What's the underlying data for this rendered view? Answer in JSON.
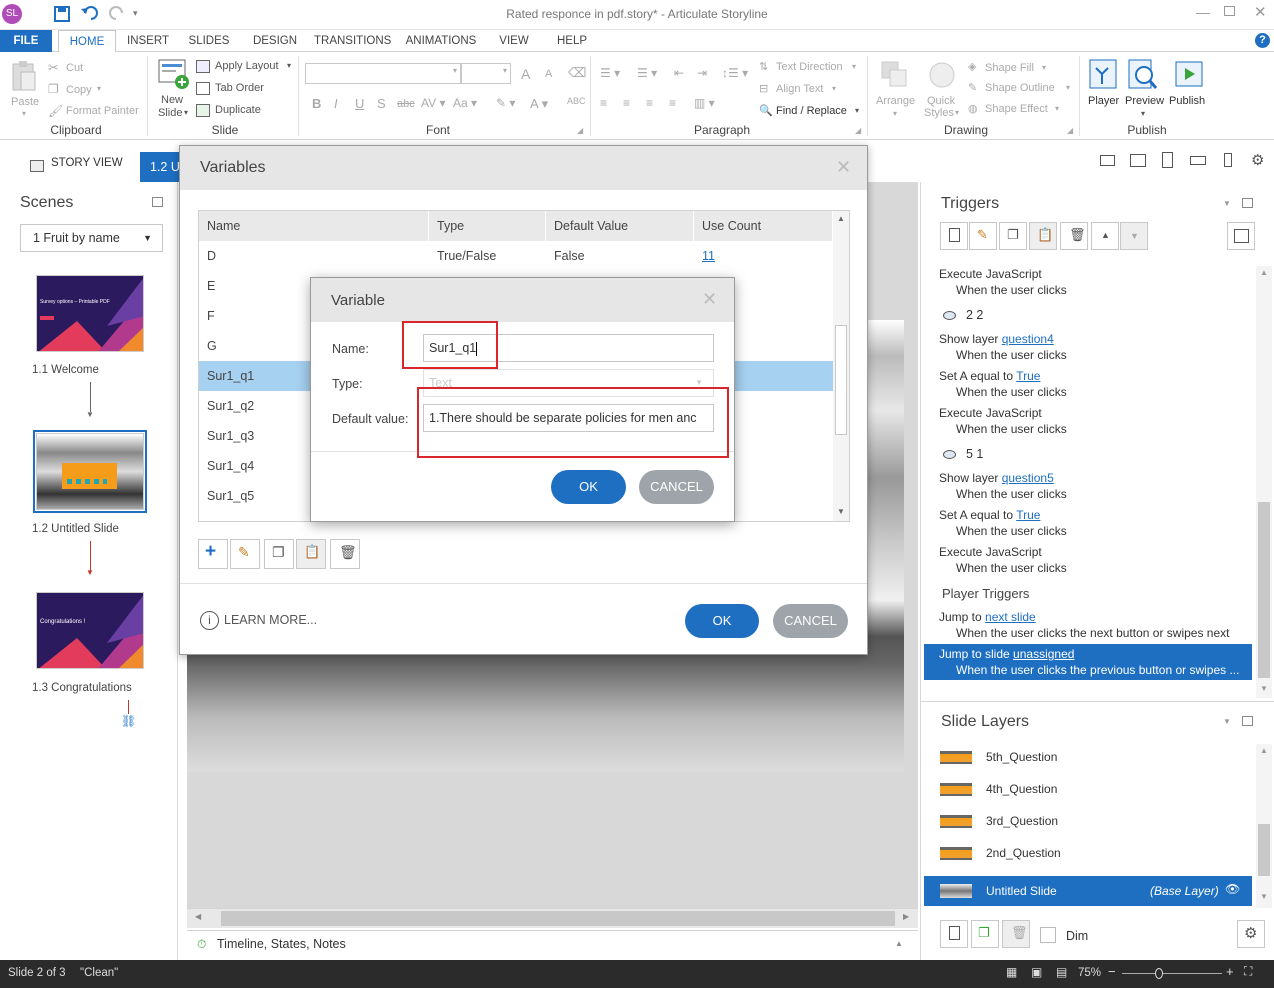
{
  "window": {
    "title": "Rated responce in pdf.story* - Articulate Storyline",
    "user_initials": "SL"
  },
  "ribbon_tabs": [
    "FILE",
    "HOME",
    "INSERT",
    "SLIDES",
    "DESIGN",
    "TRANSITIONS",
    "ANIMATIONS",
    "VIEW",
    "HELP"
  ],
  "ribbon": {
    "clipboard": {
      "paste": "Paste",
      "cut": "Cut",
      "copy": "Copy",
      "format_painter": "Format Painter",
      "group": "Clipboard"
    },
    "slide": {
      "new_slide_1": "New",
      "new_slide_2": "Slide",
      "apply_layout": "Apply Layout",
      "tab_order": "Tab Order",
      "duplicate": "Duplicate",
      "group": "Slide"
    },
    "font": {
      "group": "Font"
    },
    "paragraph": {
      "text_direction": "Text Direction",
      "align_text": "Align Text",
      "find_replace": "Find / Replace",
      "group": "Paragraph"
    },
    "drawing": {
      "arrange": "Arrange",
      "quick_styles_1": "Quick",
      "quick_styles_2": "Styles",
      "shape_fill": "Shape Fill",
      "shape_outline": "Shape Outline",
      "shape_effect": "Shape Effect",
      "group": "Drawing"
    },
    "publish": {
      "player": "Player",
      "preview": "Preview",
      "publish": "Publish",
      "group": "Publish"
    }
  },
  "view": {
    "story_view": "STORY VIEW",
    "slide_tab": "1.2 U"
  },
  "scenes": {
    "title": "Scenes",
    "dropdown": "1 Fruit by name",
    "slides": [
      {
        "label": "1.1 Welcome",
        "thumb_title": "Survey options – Printable PDF"
      },
      {
        "label": "1.2 Untitled Slide"
      },
      {
        "label": "1.3 Congratulations",
        "thumb_title": "Congratulations !"
      }
    ]
  },
  "variables_dialog": {
    "title": "Variables",
    "columns": [
      "Name",
      "Type",
      "Default Value",
      "Use Count"
    ],
    "rows": [
      {
        "name": "D",
        "type": "True/False",
        "default": "False",
        "count": "11"
      },
      {
        "name": "E",
        "type": "",
        "default": "",
        "count": ""
      },
      {
        "name": "F",
        "type": "",
        "default": "",
        "count": ""
      },
      {
        "name": "G",
        "type": "",
        "default": "",
        "count": ""
      },
      {
        "name": "Sur1_q1",
        "type": "",
        "default": "",
        "count": ""
      },
      {
        "name": "Sur1_q2",
        "type": "",
        "default": "",
        "count": ""
      },
      {
        "name": "Sur1_q3",
        "type": "",
        "default": "",
        "count": ""
      },
      {
        "name": "Sur1_q4",
        "type": "",
        "default": "",
        "count": ""
      },
      {
        "name": "Sur1_q5",
        "type": "",
        "default": "",
        "count": ""
      }
    ],
    "learn_more": "LEARN MORE...",
    "ok": "OK",
    "cancel": "CANCEL"
  },
  "variable_dialog": {
    "title": "Variable",
    "name_label": "Name:",
    "name_value": "Sur1_q1",
    "type_label": "Type:",
    "type_value": "Text",
    "default_label": "Default value:",
    "default_value": "1.There should be separate policies for men anc",
    "ok": "OK",
    "cancel": "CANCEL"
  },
  "triggers": {
    "title": "Triggers",
    "items": [
      {
        "text": "Execute JavaScript",
        "indent": false
      },
      {
        "text": "When the user clicks",
        "indent": true
      },
      {
        "text": "2 2",
        "group": true
      },
      {
        "text": "Show layer ",
        "link": "question4",
        "indent": false
      },
      {
        "text": "When the user clicks",
        "indent": true
      },
      {
        "text": "Set A equal to ",
        "link": "True",
        "indent": false
      },
      {
        "text": "When the user clicks",
        "indent": true
      },
      {
        "text": "Execute JavaScript",
        "indent": false
      },
      {
        "text": "When the user clicks",
        "indent": true
      },
      {
        "text": "5 1",
        "group": true
      },
      {
        "text": "Show layer ",
        "link": "question5",
        "indent": false
      },
      {
        "text": "When the user clicks",
        "indent": true
      },
      {
        "text": "Set A equal to ",
        "link": "True",
        "indent": false
      },
      {
        "text": "When the user clicks",
        "indent": true
      },
      {
        "text": "Execute JavaScript",
        "indent": false
      },
      {
        "text": "When the user clicks",
        "indent": true
      }
    ],
    "player_triggers": "Player Triggers",
    "jump_next": "Jump to ",
    "jump_next_link": "next slide",
    "jump_next_when": "When the user clicks the next button or swipes next",
    "jump_prev": "Jump to slide ",
    "jump_prev_link": "unassigned",
    "jump_prev_when": "When the user clicks the previous button or swipes ..."
  },
  "slide_layers": {
    "title": "Slide Layers",
    "layers": [
      "5th_Question",
      "4th_Question",
      "3rd_Question",
      "2nd_Question"
    ],
    "base": "Untitled Slide",
    "base_tag": "(Base Layer)",
    "dim": "Dim"
  },
  "timeline": "Timeline, States, Notes",
  "status": {
    "slide": "Slide 2 of 3",
    "theme": "\"Clean\"",
    "zoom": "75%"
  }
}
